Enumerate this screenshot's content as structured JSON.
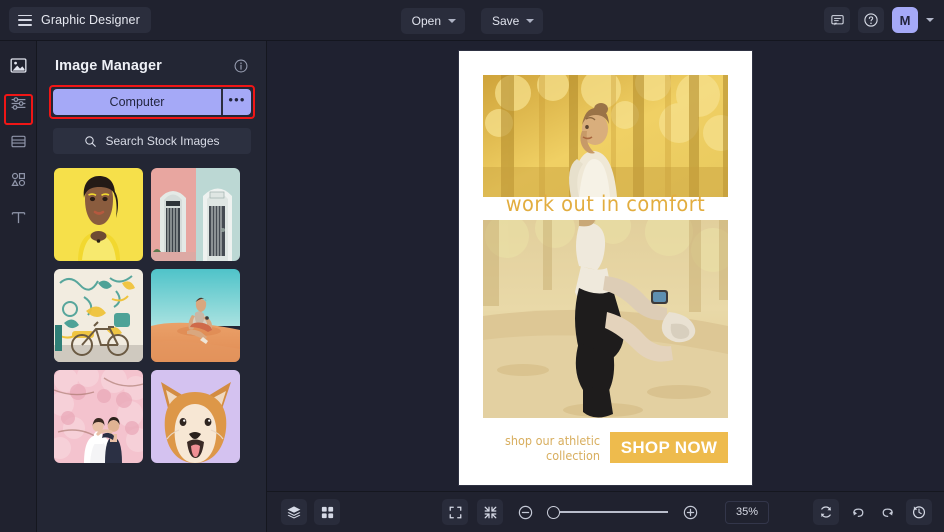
{
  "app": {
    "title": "Graphic Designer",
    "menu_icon": "hamburger-icon"
  },
  "topbar": {
    "open_label": "Open",
    "save_label": "Save",
    "comment_icon": "comment-icon",
    "help_icon": "help-circle-icon",
    "avatar_initial": "M",
    "avatar_color": "#a5a9f7"
  },
  "rail": {
    "items": [
      {
        "name": "image-manager",
        "icon": "image-icon",
        "active": true
      },
      {
        "name": "adjustments",
        "icon": "sliders-icon",
        "active": false
      },
      {
        "name": "layers",
        "icon": "frame-icon",
        "active": false
      },
      {
        "name": "shapes",
        "icon": "shapes-icon",
        "active": false
      },
      {
        "name": "text",
        "icon": "text-icon",
        "active": false
      }
    ],
    "highlight_color": "#f01616"
  },
  "panel": {
    "title": "Image Manager",
    "info_icon": "info-circle-icon",
    "computer_label": "Computer",
    "more_label": "•••",
    "computer_button_color": "#a5a9f7",
    "highlight_color": "#f01616",
    "search_label": "Search Stock Images",
    "search_icon": "search-icon",
    "thumbnails": [
      {
        "name": "thumbnail-woman-yellow",
        "alt": "Woman in yellow shirt on yellow background"
      },
      {
        "name": "thumbnail-doors",
        "alt": "Pink and teal doorways"
      },
      {
        "name": "thumbnail-bicycle-mural",
        "alt": "Bicycle in front of painted mural wall"
      },
      {
        "name": "thumbnail-desert-man",
        "alt": "Man sitting on desert sand dune"
      },
      {
        "name": "thumbnail-wedding",
        "alt": "Wedding couple among cherry blossoms"
      },
      {
        "name": "thumbnail-shiba-dog",
        "alt": "Shiba Inu dog on lavender background"
      }
    ]
  },
  "canvas": {
    "poster": {
      "background": "#ffffff",
      "headline": "work out in comfort",
      "headline_color": "#e2ad3f",
      "footer_line1": "shop our athletic",
      "footer_line2": "collection",
      "footer_color": "#d8ae5e",
      "cta_label": "SHOP NOW",
      "cta_color": "#eebb4d",
      "image_top_alt": "Woman jogging among autumn trees",
      "image_mid_alt": "Woman stretching on a path"
    }
  },
  "bottombar": {
    "layers_icon": "layers-icon",
    "grid_icon": "grid-icon",
    "fit_icon": "expand-frame-icon",
    "shrink_icon": "collapse-frame-icon",
    "zoom_out_icon": "zoom-out-icon",
    "zoom_in_icon": "zoom-in-icon",
    "zoom_value": "35%",
    "zoom_percent": 35,
    "refresh_icon": "refresh-icon",
    "undo_icon": "undo-icon",
    "redo_icon": "redo-icon",
    "history_icon": "history-icon"
  }
}
